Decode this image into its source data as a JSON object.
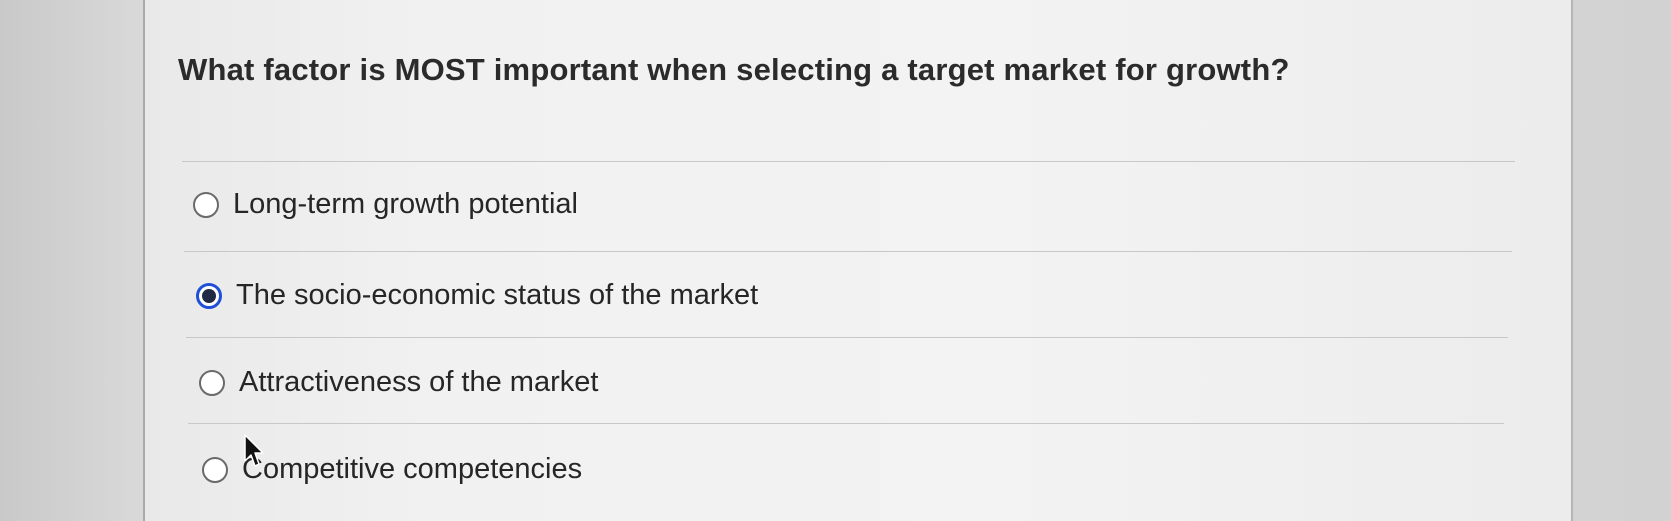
{
  "question": {
    "text": "What factor is MOST important when selecting a target market for growth?"
  },
  "answers": [
    {
      "label": "Long-term growth potential",
      "selected": false
    },
    {
      "label": "The socio-economic status of the market",
      "selected": true
    },
    {
      "label": "Attractiveness of the market",
      "selected": false
    },
    {
      "label": "Competitive competencies",
      "selected": false
    }
  ],
  "colors": {
    "selected_ring": "#1f4fd8",
    "selected_dot": "#1f2a44",
    "text": "#262626"
  },
  "icons": {
    "cursor": "mouse-pointer-icon"
  }
}
